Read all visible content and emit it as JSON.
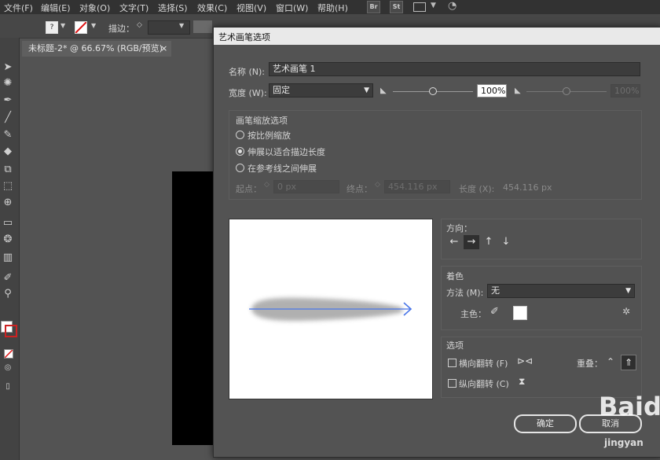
{
  "menubar": {
    "items": [
      "文件(F)",
      "编辑(E)",
      "对象(O)",
      "文字(T)",
      "选择(S)",
      "效果(C)",
      "视图(V)",
      "窗口(W)",
      "帮助(H)"
    ],
    "bridge_badge": "Br",
    "stock_badge": "St"
  },
  "controlbar": {
    "stroke_label": "描边："
  },
  "document": {
    "tab_title": "未标题-2* @ 66.67% (RGB/预览)",
    "tab_close": "×"
  },
  "dialog": {
    "title": "艺术画笔选项",
    "name_label": "名称 (N):",
    "name_value": "艺术画笔 1",
    "width_label": "宽度 (W):",
    "width_value": "固定",
    "width_percent": "100%",
    "width_percent_disabled": "100%",
    "scale_group": {
      "title": "画笔缩放选项",
      "options": [
        "按比例缩放",
        "伸展以适合描边长度",
        "在参考线之间伸展"
      ],
      "selected_index": 1,
      "start_label": "起点：",
      "start_value": "0 px",
      "end_label": "终点：",
      "end_value": "454.116 px",
      "length_label": "长度 (X):",
      "length_value": "454.116 px"
    },
    "direction": {
      "title": "方向：",
      "buttons": [
        "←",
        "→",
        "↑",
        "↓"
      ],
      "active_index": 1
    },
    "colorization": {
      "title": "着色",
      "method_label": "方法 (M):",
      "method_value": "无",
      "key_color_label": "主色：",
      "key_color": "#ffffff"
    },
    "options": {
      "title": "选项",
      "flip_along_label": "横向翻转 (F)",
      "flip_across_label": "纵向翻转 (C)",
      "overlap_label": "重叠："
    },
    "ok_label": "确定",
    "cancel_label": "取消"
  },
  "watermark": {
    "brand": "Baidu",
    "sub": "jingyan"
  },
  "colors": {
    "accent_arrow": "#4a76e8"
  }
}
